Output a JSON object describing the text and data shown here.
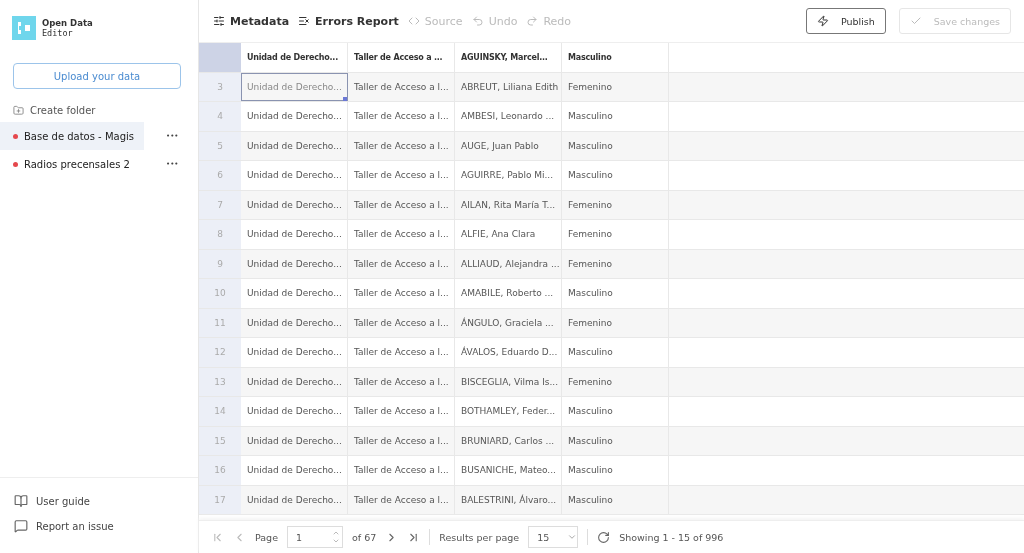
{
  "logo": {
    "line1": "Open Data",
    "line2": "Editor"
  },
  "upload_button": "Upload your data",
  "create_folder": "Create folder",
  "files": [
    {
      "name": "Base de datos - Magis",
      "selected": true,
      "color": "#e5484d",
      "menu": "•••"
    },
    {
      "name": "Radios precensales 2",
      "selected": false,
      "color": "#e5484d",
      "menu": "•••"
    }
  ],
  "footer_links": [
    {
      "kind": "guide",
      "label": "User guide"
    },
    {
      "kind": "issue",
      "label": "Report an issue"
    }
  ],
  "toolbar": [
    {
      "kind": "metadata",
      "label": "Metadata",
      "disabled": false
    },
    {
      "kind": "errors",
      "label": "Errors Report",
      "disabled": false
    },
    {
      "kind": "source",
      "label": "Source",
      "disabled": true
    },
    {
      "kind": "undo",
      "label": "Undo",
      "disabled": true
    },
    {
      "kind": "redo",
      "label": "Redo",
      "disabled": true
    }
  ],
  "publish_button": {
    "label": "Publish",
    "disabled": false
  },
  "save_button": {
    "label": "Save changes",
    "disabled": true
  },
  "table": {
    "columns": [
      "Unidad de Derecho...",
      "Taller de Acceso a ...",
      "AGUINSKY, Marcel...",
      "Masculino"
    ],
    "rows": [
      {
        "number": "3",
        "selected": true,
        "cells": [
          "Unidad de Derecho...",
          "Taller de Acceso a l...",
          "ABREUT, Liliana Edith",
          "Femenino"
        ]
      },
      {
        "number": "4",
        "selected": false,
        "cells": [
          "Unidad de Derecho...",
          "Taller de Acceso a l...",
          "AMBESI, Leonardo ...",
          "Masculino"
        ]
      },
      {
        "number": "5",
        "selected": false,
        "cells": [
          "Unidad de Derecho...",
          "Taller de Acceso a l...",
          "AUGE, Juan Pablo",
          "Masculino"
        ]
      },
      {
        "number": "6",
        "selected": false,
        "cells": [
          "Unidad de Derecho...",
          "Taller de Acceso a l...",
          "AGUIRRE, Pablo Mi...",
          "Masculino"
        ]
      },
      {
        "number": "7",
        "selected": false,
        "cells": [
          "Unidad de Derecho...",
          "Taller de Acceso a l...",
          "AILAN, Rita María T...",
          "Femenino"
        ]
      },
      {
        "number": "8",
        "selected": false,
        "cells": [
          "Unidad de Derecho...",
          "Taller de Acceso a l...",
          "ALFIE, Ana Clara",
          "Femenino"
        ]
      },
      {
        "number": "9",
        "selected": false,
        "cells": [
          "Unidad de Derecho...",
          "Taller de Acceso a l...",
          "ALLIAUD, Alejandra ...",
          "Femenino"
        ]
      },
      {
        "number": "10",
        "selected": false,
        "cells": [
          "Unidad de Derecho...",
          "Taller de Acceso a l...",
          "AMABILE, Roberto ...",
          "Masculino"
        ]
      },
      {
        "number": "11",
        "selected": false,
        "cells": [
          "Unidad de Derecho...",
          "Taller de Acceso a l...",
          "ÁNGULO, Graciela ...",
          "Femenino"
        ]
      },
      {
        "number": "12",
        "selected": false,
        "cells": [
          "Unidad de Derecho...",
          "Taller de Acceso a l...",
          "ÁVALOS, Eduardo D...",
          "Masculino"
        ]
      },
      {
        "number": "13",
        "selected": false,
        "cells": [
          "Unidad de Derecho...",
          "Taller de Acceso a l...",
          "BISCEGLIA, Vilma Is...",
          "Femenino"
        ]
      },
      {
        "number": "14",
        "selected": false,
        "cells": [
          "Unidad de Derecho...",
          "Taller de Acceso a l...",
          "BOTHAMLEY, Feder...",
          "Masculino"
        ]
      },
      {
        "number": "15",
        "selected": false,
        "cells": [
          "Unidad de Derecho...",
          "Taller de Acceso a l...",
          "BRUNIARD, Carlos ...",
          "Masculino"
        ]
      },
      {
        "number": "16",
        "selected": false,
        "cells": [
          "Unidad de Derecho...",
          "Taller de Acceso a l...",
          "BUSANICHE, Mateo...",
          "Masculino"
        ]
      },
      {
        "number": "17",
        "selected": false,
        "cells": [
          "Unidad de Derecho...",
          "Taller de Acceso a l...",
          "BALESTRINI, Álvaro...",
          "Masculino"
        ]
      }
    ]
  },
  "pagination": {
    "page_label": "Page",
    "page": "1",
    "of_label": "of 67",
    "per_page_label": "Results per page",
    "per_page": "15",
    "showing": "Showing 1 - 15 of 996"
  }
}
